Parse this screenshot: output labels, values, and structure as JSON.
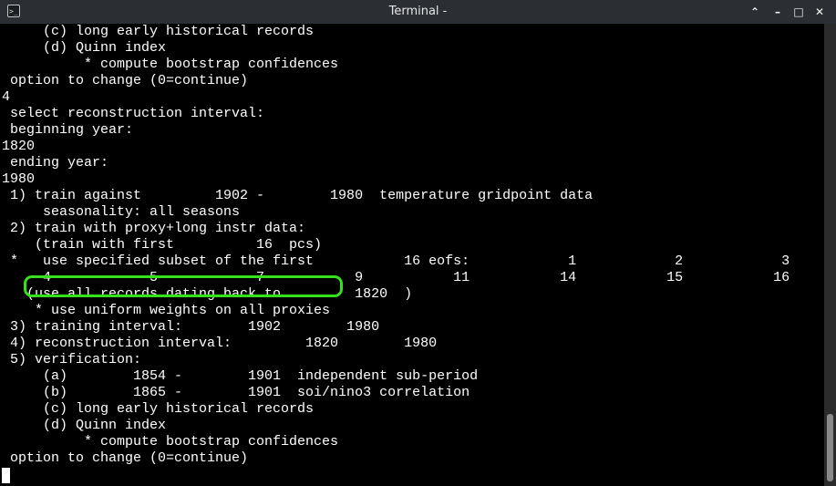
{
  "window": {
    "title": "Terminal -",
    "app_icon_glyph": ">_",
    "controls": {
      "collapse": "⌃",
      "minimize": "–",
      "maximize": "□",
      "close": "✕"
    }
  },
  "terminal": {
    "lines": [
      "     (c) long early historical records",
      "     (d) Quinn index",
      "          * compute bootstrap confidences",
      " option to change (0=continue)",
      "4",
      " select reconstruction interval:",
      " beginning year:",
      "1820",
      " ending year:",
      "1980",
      " 1) train against         1902 -        1980  temperature gridpoint data",
      "     seasonality: all seasons",
      " 2) train with proxy+long instr data:",
      "    (train with first          16  pcs)",
      " *   use specified subset of the first           16 eofs:            1            2            3",
      "     4            5            7           9           11           14           15           16",
      "   (use all records dating back to         1820  )",
      "    * use uniform weights on all proxies",
      " 3) training interval:        1902        1980",
      " 4) reconstruction interval:         1820        1980",
      " 5) verification:",
      "     (a)        1854 -        1901  independent sub-period",
      "     (b)        1865 -        1901  soi/nino3 correlation",
      "     (c) long early historical records",
      "     (d) Quinn index",
      "          * compute bootstrap confidences",
      " option to change (0=continue)"
    ]
  },
  "colors": {
    "background": "#000000",
    "text": "#ffffff",
    "highlight": "#37e01c",
    "titlebar": "#2b2e33"
  }
}
